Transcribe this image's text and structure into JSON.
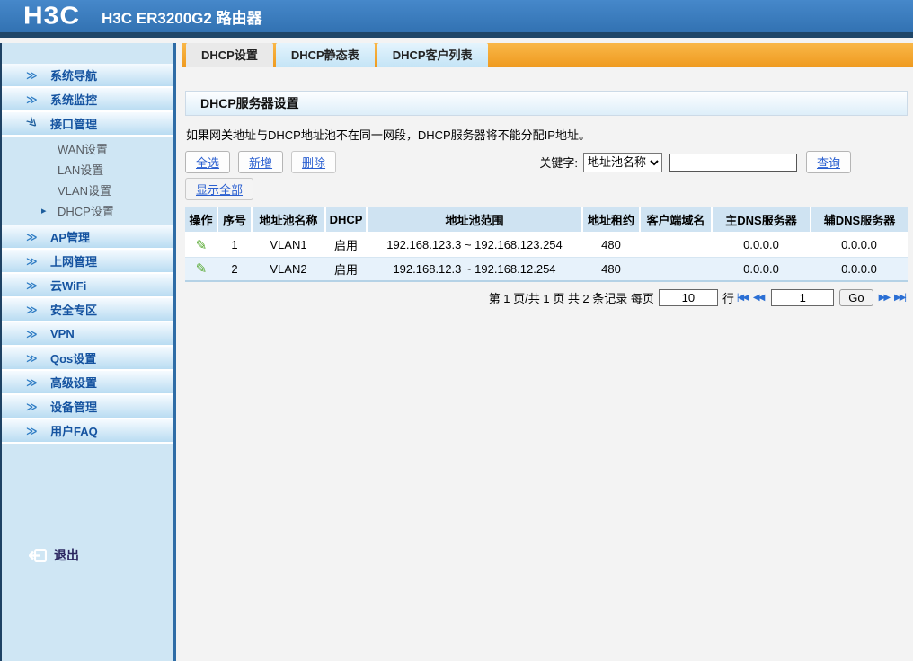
{
  "header": {
    "logo": "H3C",
    "title": "H3C ER3200G2 路由器"
  },
  "sidebar": {
    "groups": [
      {
        "label": "系统导航",
        "expanded": false
      },
      {
        "label": "系统监控",
        "expanded": false
      },
      {
        "label": "接口管理",
        "expanded": true,
        "children": [
          {
            "label": "WAN设置",
            "active": false
          },
          {
            "label": "LAN设置",
            "active": false
          },
          {
            "label": "VLAN设置",
            "active": false
          },
          {
            "label": "DHCP设置",
            "active": true
          }
        ]
      },
      {
        "label": "AP管理",
        "expanded": false
      },
      {
        "label": "上网管理",
        "expanded": false
      },
      {
        "label": "云WiFi",
        "expanded": false
      },
      {
        "label": "安全专区",
        "expanded": false
      },
      {
        "label": "VPN",
        "expanded": false
      },
      {
        "label": "Qos设置",
        "expanded": false
      },
      {
        "label": "高级设置",
        "expanded": false
      },
      {
        "label": "设备管理",
        "expanded": false
      },
      {
        "label": "用户FAQ",
        "expanded": false
      }
    ],
    "logout": "退出"
  },
  "tabs": [
    {
      "label": "DHCP设置",
      "active": true
    },
    {
      "label": "DHCP静态表",
      "active": false
    },
    {
      "label": "DHCP客户列表",
      "active": false
    }
  ],
  "panel": {
    "title": "DHCP服务器设置"
  },
  "notice": "如果网关地址与DHCP地址池不在同一网段，DHCP服务器将不能分配IP地址。",
  "toolbar": {
    "select_all": "全选",
    "add": "新增",
    "delete": "删除",
    "show_all": "显示全部",
    "keyword_label": "关键字:",
    "keyword_selected": "地址池名称",
    "keyword_input_value": "",
    "query": "查询"
  },
  "table": {
    "columns": [
      "操作",
      "序号",
      "地址池名称",
      "DHCP",
      "地址池范围",
      "地址租约",
      "客户端域名",
      "主DNS服务器",
      "辅DNS服务器"
    ],
    "rows": [
      {
        "index": "1",
        "pool": "VLAN1",
        "dhcp": "启用",
        "range": "192.168.123.3 ~ 192.168.123.254",
        "lease": "480",
        "domain": "",
        "dns1": "0.0.0.0",
        "dns2": "0.0.0.0"
      },
      {
        "index": "2",
        "pool": "VLAN2",
        "dhcp": "启用",
        "range": "192.168.12.3 ~ 192.168.12.254",
        "lease": "480",
        "domain": "",
        "dns1": "0.0.0.0",
        "dns2": "0.0.0.0"
      }
    ],
    "edit_icon_glyph": "✎"
  },
  "pagination": {
    "summary": "第 1 页/共 1 页 共 2 条记录 每页",
    "page_size": "10",
    "rows_suffix": "行",
    "first_icon": "|◀◀",
    "prev_icon": "◀◀",
    "goto_value": "1",
    "go_label": "Go",
    "next_icon": "▶▶",
    "last_icon": "▶▶|"
  },
  "colors": {
    "header_blue": "#3a7abc",
    "header_dark_band": "#1f4668",
    "tab_bar_orange": "#f4a02c",
    "sidebar_bg": "#cfe6f4",
    "nav_text_blue": "#1553a0",
    "link_blue": "#2a5fd0",
    "table_header_bg": "#cfe3f2",
    "row_alt_bg": "#e7f2fb",
    "pencil_green": "#54a82e"
  }
}
